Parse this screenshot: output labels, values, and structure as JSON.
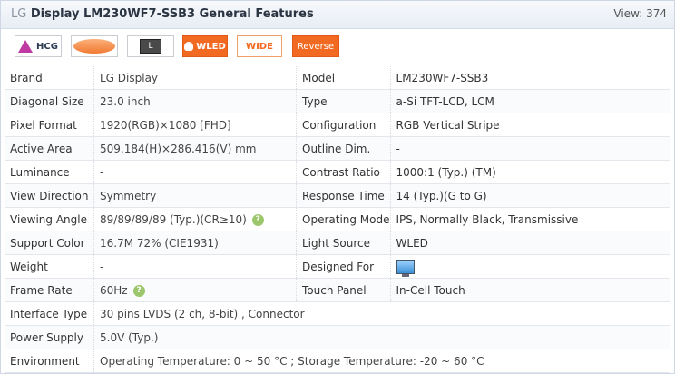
{
  "header": {
    "brand_glyph": "LG",
    "title": "Display LM230WF7-SSB3 General Features",
    "views": "View: 374"
  },
  "badges": {
    "hcg": "HCG",
    "l": "L",
    "wled": "WLED",
    "wide": "WIDE",
    "reverse": "Reverse"
  },
  "rows": [
    {
      "l1": "Brand",
      "v1": "LG Display",
      "l2": "Model",
      "v2": "LM230WF7-SSB3"
    },
    {
      "l1": "Diagonal Size",
      "v1": "23.0 inch",
      "l2": "Type",
      "v2": "a-Si TFT-LCD, LCM"
    },
    {
      "l1": "Pixel Format",
      "v1": "1920(RGB)×1080   [FHD]",
      "l2": "Configuration",
      "v2": "RGB Vertical Stripe"
    },
    {
      "l1": "Active Area",
      "v1": "509.184(H)×286.416(V) mm",
      "l2": "Outline Dim.",
      "v2": "-"
    },
    {
      "l1": "Luminance",
      "v1": "-",
      "l2": "Contrast Ratio",
      "v2": "1000:1 (Typ.) (TM)"
    },
    {
      "l1": "View Direction",
      "v1": "Symmetry",
      "l2": "Response Time",
      "v2": "14 (Typ.)(G to G)"
    },
    {
      "l1": "Viewing Angle",
      "v1": "89/89/89/89 (Typ.)(CR≥10)",
      "l2": "Operating Mode",
      "v2": "IPS, Normally Black, Transmissive"
    },
    {
      "l1": "Support Color",
      "v1": "16.7M   72% (CIE1931)",
      "l2": "Light Source",
      "v2": "WLED"
    },
    {
      "l1": "Weight",
      "v1": "-",
      "l2": "Designed For",
      "v2": ""
    },
    {
      "l1": "Frame Rate",
      "v1": "60Hz",
      "l2": "Touch Panel",
      "v2": "In-Cell Touch"
    },
    {
      "l1": "Interface Type",
      "v1": "30 pins   LVDS (2 ch, 8-bit) , Connector"
    },
    {
      "l1": "Power Supply",
      "v1": "5.0V (Typ.)"
    },
    {
      "l1": "Environment",
      "v1": "Operating Temperature: 0 ~ 50 °C ; Storage Temperature: -20 ~ 60 °C"
    }
  ],
  "icons": {
    "help": "help-icon",
    "monitor": "monitor-icon"
  }
}
